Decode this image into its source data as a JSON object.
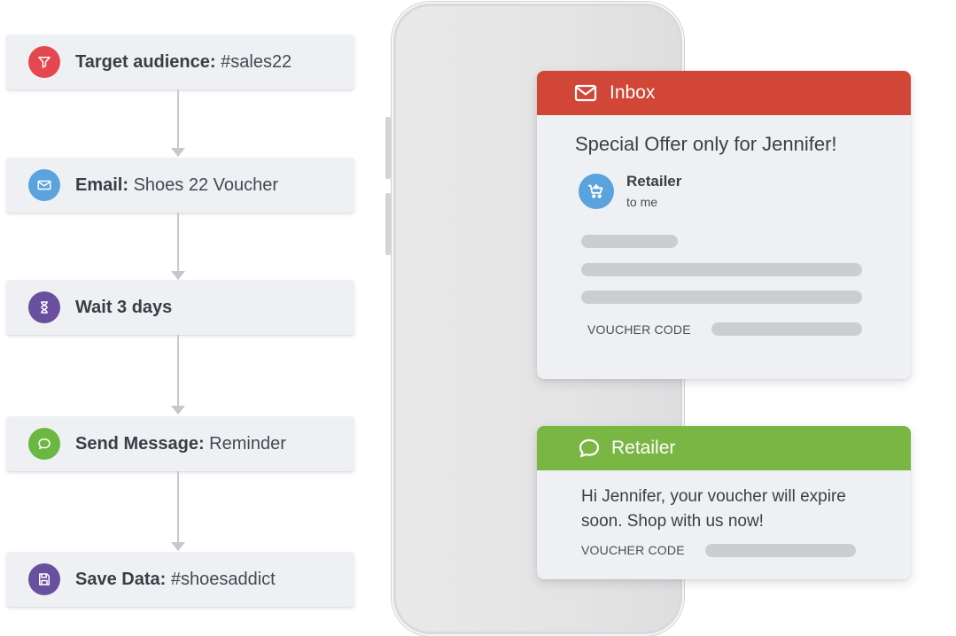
{
  "flow": {
    "steps": [
      {
        "label": "Target audience:",
        "value": "#sales22",
        "icon": "funnel-icon",
        "color": "#e4474f"
      },
      {
        "label": "Email:",
        "value": "Shoes 22 Voucher",
        "icon": "envelope-icon",
        "color": "#5ba3dc"
      },
      {
        "label": "Wait 3 days",
        "value": "",
        "icon": "hourglass-icon",
        "color": "#6a4f9e"
      },
      {
        "label": "Send Message:",
        "value": "Reminder",
        "icon": "chat-bubble-icon",
        "color": "#6ab742"
      },
      {
        "label": "Save Data:",
        "value": "#shoesaddict",
        "icon": "floppy-disk-icon",
        "color": "#6a4f9e"
      }
    ]
  },
  "email_card": {
    "header": "Inbox",
    "header_color": "#d14637",
    "subject": "Special Offer only for Jennifer!",
    "sender": "Retailer",
    "recipient": "to me",
    "voucher_label": "VOUCHER CODE",
    "icons": {
      "header": "envelope-icon",
      "sender": "shopping-cart-icon"
    }
  },
  "message_card": {
    "header": "Retailer",
    "header_color": "#79b643",
    "body": "Hi Jennifer, your voucher will expire soon. Shop with us now!",
    "voucher_label": "VOUCHER CODE",
    "icons": {
      "header": "chat-bubble-icon"
    }
  }
}
